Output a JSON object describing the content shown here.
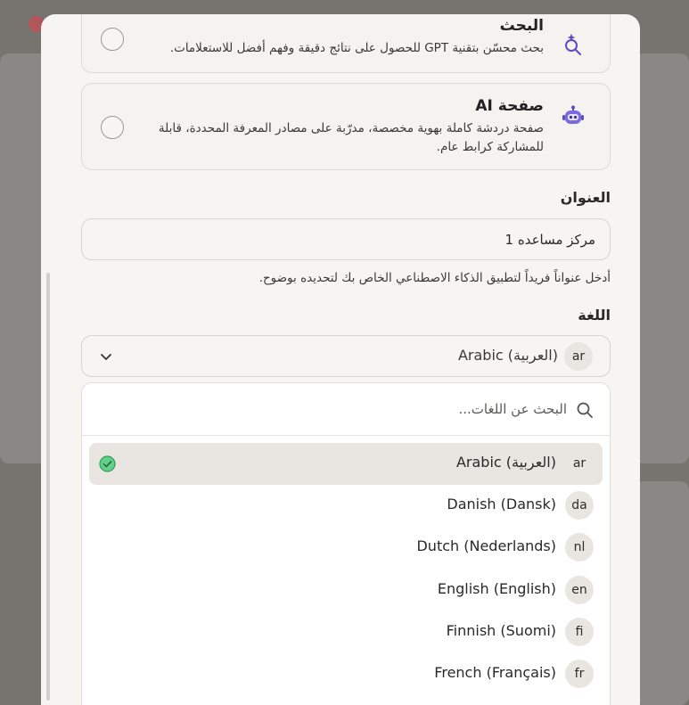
{
  "options": [
    {
      "title": "البحث",
      "description": "بحث محسّن بتقنية GPT للحصول على نتائج دقيقة وفهم أفضل للاستعلامات.",
      "icon": "sparkle-search-icon",
      "selected": false
    },
    {
      "title": "صفحة AI",
      "description": "صفحة دردشة كاملة بهوية مخصصة، مدرّبة على مصادر المعرفة المحددة، قابلة للمشاركة كرابط عام.",
      "icon": "robot-icon",
      "selected": false
    }
  ],
  "title_field": {
    "label": "العنوان",
    "value": "مركز مساعده 1",
    "hint": "أدخل عنواناً فريداً لتطبيق الذكاء الاصطناعي الخاص بك لتحديده بوضوح."
  },
  "language_field": {
    "label": "اللغة",
    "selected_code": "ar",
    "selected_label": "Arabic (العربية)",
    "search_placeholder": "البحث عن اللغات...",
    "options": [
      {
        "code": "ar",
        "label": "Arabic (العربية)",
        "selected": true
      },
      {
        "code": "da",
        "label": "Danish (Dansk)",
        "selected": false
      },
      {
        "code": "nl",
        "label": "Dutch (Nederlands)",
        "selected": false
      },
      {
        "code": "en",
        "label": "English (English)",
        "selected": false
      },
      {
        "code": "fi",
        "label": "Finnish (Suomi)",
        "selected": false
      },
      {
        "code": "fr",
        "label": "French (Français)",
        "selected": false
      }
    ]
  },
  "colors": {
    "accent_purple": "#5b4bc4",
    "check_green": "#3bb36a",
    "modal_bg": "#f7f5f1"
  }
}
